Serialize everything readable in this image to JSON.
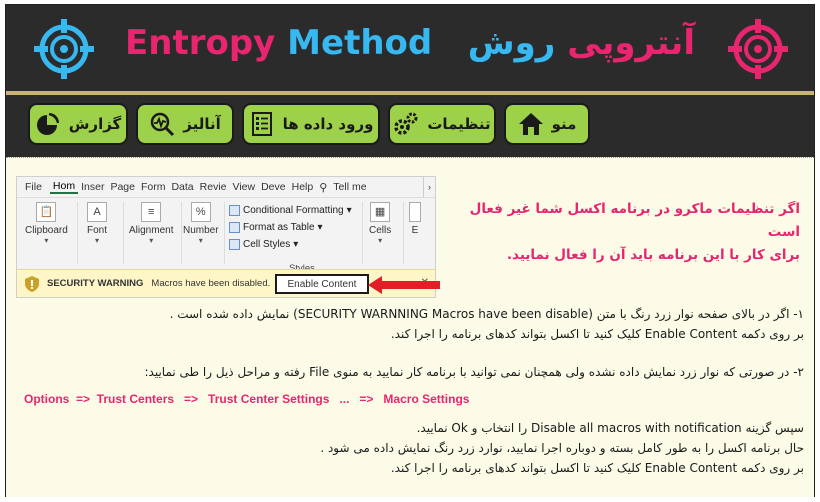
{
  "header": {
    "title_en_1": "Entropy",
    "title_en_2": "Method",
    "title_fa_1": "آنتروپی",
    "title_fa_2": "روش",
    "logo_icon": "crosshair-icon"
  },
  "menu": [
    {
      "label": "منو",
      "icon": "home-icon"
    },
    {
      "label": "تنظیمات",
      "icon": "gears-icon"
    },
    {
      "label": "ورود داده ها",
      "icon": "checklist-icon"
    },
    {
      "label": "آنالیز",
      "icon": "magnifier-chart-icon"
    },
    {
      "label": "گزارش",
      "icon": "pie-chart-icon"
    }
  ],
  "excel": {
    "tabs": [
      "File",
      "Hom",
      "Inser",
      "Page",
      "Form",
      "Data",
      "Revie",
      "View",
      "Deve",
      "Help",
      "Tell me"
    ],
    "groups": {
      "clipboard": "Clipboard",
      "font": "Font",
      "alignment": "Alignment",
      "number": "Number",
      "cells": "Cells",
      "editing": "E"
    },
    "styles": [
      "Conditional Formatting",
      "Format as Table",
      "Cell Styles"
    ],
    "styles_group_label": "Styles",
    "security": {
      "title": "SECURITY WARNING",
      "message": "Macros have been disabled.",
      "button": "Enable Content"
    }
  },
  "callout": {
    "line1": "اگر تنظیمات ماکرو در برنامه اکسل شما غیر فعال است",
    "line2": "برای کار با این برنامه باید آن را فعال نمایید."
  },
  "steps": {
    "p1_line1": "۱- اگر در بالای صفحه نوار زرد رنگ با متن (SECURITY WARNNING Macros have been disable) نمایش داده شده است .",
    "p1_line2": "بر روی دکمه Enable Content  کلیک کنید تا اکسل بتواند کدهای برنامه را اجرا کند.",
    "p2_line1": "۲- در صورتی که نوار زرد نمایش داده نشده ولی همچنان نمی توانید با برنامه کار نمایید به منوی File رفته و مراحل ذیل را طی نمایید:",
    "path": "Options  =>  Trust Centers   =>   Trust Center Settings   ...   =>   Macro Settings",
    "p3_line1": "سپس گزینه Disable all macros with notification را انتخاب و Ok نمایید.",
    "p3_line2": "حال برنامه اکسل را به طور کامل بسته و دوباره اجرا نمایید، نوارد زرد رنگ نمایش داده می شود .",
    "p3_line3": "بر روی دکمه Enable Content  کلیک کنید تا اکسل بتواند کدهای برنامه را اجرا کند."
  },
  "colors": {
    "pink": "#e8256e",
    "blue": "#37b8f0",
    "green": "#9ed14a",
    "dark": "#2b2b2b"
  }
}
